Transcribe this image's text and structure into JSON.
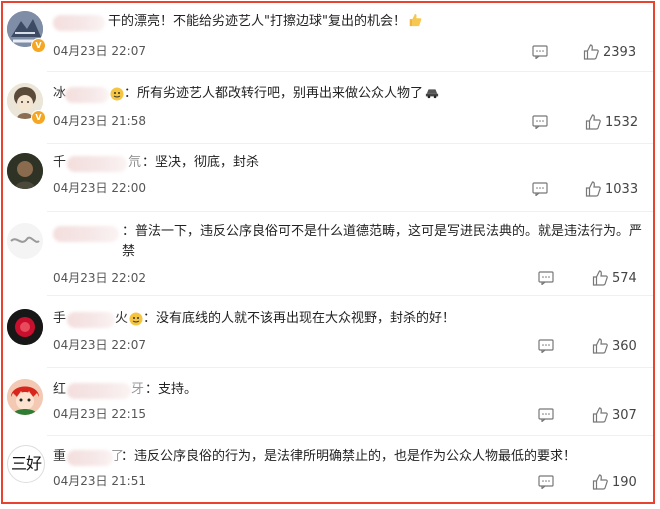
{
  "comments": [
    {
      "name_fragment": "",
      "name_suffix": "",
      "text": "干的漂亮！不能给劣迹艺人\"打擦边球\"复出的机会！",
      "emoji": "thumbs-up",
      "date": "04月23日",
      "time": "22:07",
      "likes": "2393"
    },
    {
      "name_fragment": "冰",
      "name_suffix": "",
      "text": "：所有劣迹艺人都改转行吧，别再出来做公众人物了",
      "emoji": "car",
      "date": "04月23日",
      "time": "21:58",
      "likes": "1532"
    },
    {
      "name_fragment": "千",
      "name_suffix": "氘",
      "text": "：坚决，彻底，封杀",
      "emoji": "",
      "date": "04月23日",
      "time": "22:00",
      "likes": "1033"
    },
    {
      "name_fragment": "",
      "name_suffix": "",
      "text": "：普法一下，违反公序良俗可不是什么道德范畴，这可是写进民法典的。就是违法行为。严禁",
      "emoji": "",
      "date": "04月23日",
      "time": "22:02",
      "likes": "574"
    },
    {
      "name_fragment": "手",
      "name_suffix": "火",
      "text": "：没有底线的人就不该再出现在大众视野，封杀的好！",
      "emoji": "",
      "date": "04月23日",
      "time": "22:07",
      "likes": "360"
    },
    {
      "name_fragment": "红",
      "name_suffix": "牙",
      "text": "：支持。",
      "emoji": "",
      "date": "04月23日",
      "time": "22:15",
      "likes": "307"
    },
    {
      "name_fragment": "重",
      "name_suffix": "了",
      "text": "：违反公序良俗的行为，是法律所明确禁止的，也是作为公众人物最低的要求！",
      "emoji": "",
      "date": "04月23日",
      "time": "21:51",
      "likes": "190"
    }
  ],
  "avatar_6_text": "三好",
  "colors": {
    "frame": "#e8432e",
    "badge": "#f5a623"
  }
}
